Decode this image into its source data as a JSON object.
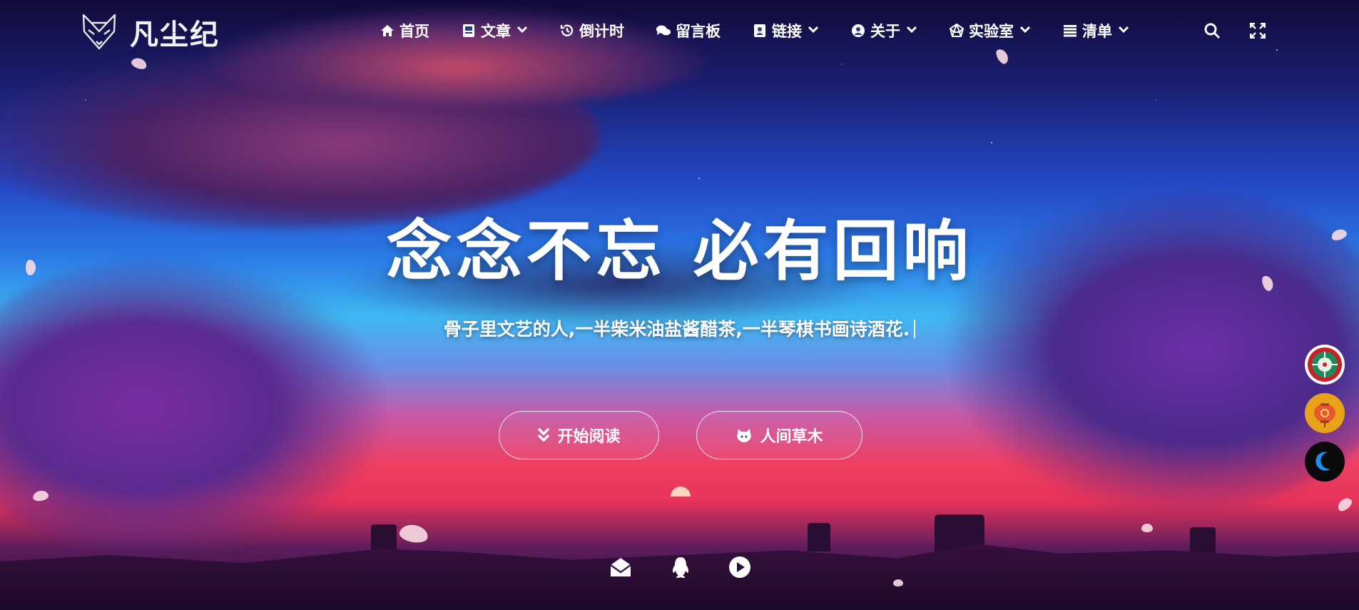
{
  "site": {
    "name": "凡尘纪",
    "logo_icon": "fox-logo-icon"
  },
  "nav": {
    "items": [
      {
        "label": "首页",
        "icon": "home-icon"
      },
      {
        "label": "文章",
        "icon": "book-icon",
        "has_dropdown": true
      },
      {
        "label": "倒计时",
        "icon": "history-icon"
      },
      {
        "label": "留言板",
        "icon": "comments-icon"
      },
      {
        "label": "链接",
        "icon": "address-book-icon",
        "has_dropdown": true
      },
      {
        "label": "关于",
        "icon": "user-circle-icon",
        "has_dropdown": true
      },
      {
        "label": "实验室",
        "icon": "dice-icon",
        "has_dropdown": true
      },
      {
        "label": "清单",
        "icon": "list-icon",
        "has_dropdown": true
      }
    ],
    "search_icon": "search-icon",
    "fullscreen_icon": "expand-icon"
  },
  "hero": {
    "title": "念念不忘 必有回响",
    "subtitle": "骨子里文艺的人,一半柴米油盐酱醋茶,一半琴棋书画诗酒花."
  },
  "buttons": {
    "start_reading": {
      "label": "开始阅读",
      "icon": "double-chevron-down-icon"
    },
    "world": {
      "label": "人间草木",
      "icon": "github-icon"
    }
  },
  "social": [
    {
      "name": "email",
      "icon": "envelope-open-icon"
    },
    {
      "name": "qq",
      "icon": "qq-penguin-icon"
    },
    {
      "name": "music",
      "icon": "play-circle-icon"
    }
  ],
  "side_buttons": [
    {
      "name": "music-player-disc",
      "icon": "vinyl-disc-icon",
      "color": "#1e8a5a"
    },
    {
      "name": "lantern",
      "icon": "lantern-icon",
      "color": "#e8a21a"
    },
    {
      "name": "dark-mode",
      "icon": "moon-icon",
      "color": "#0a0a0a"
    }
  ]
}
